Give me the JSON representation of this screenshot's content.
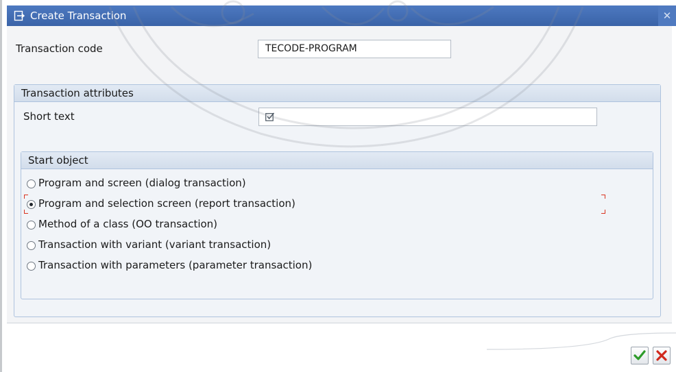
{
  "dialog": {
    "title": "Create Transaction",
    "close_glyph": "✕"
  },
  "form": {
    "transaction_code_label": "Transaction code",
    "transaction_code_value": "TECODE-PROGRAM"
  },
  "attributes_group": {
    "title": "Transaction attributes",
    "short_text_label": "Short text",
    "short_text_value": ""
  },
  "start_object": {
    "title": "Start object",
    "options": [
      {
        "label": "Program and screen (dialog transaction)",
        "selected": false
      },
      {
        "label": "Program and selection screen (report transaction)",
        "selected": true
      },
      {
        "label": "Method of a class (OO transaction)",
        "selected": false
      },
      {
        "label": "Transaction with variant (variant transaction)",
        "selected": false
      },
      {
        "label": "Transaction with parameters (parameter transaction)",
        "selected": false
      }
    ]
  },
  "footer": {
    "confirm_icon": "check-icon",
    "cancel_icon": "cross-icon"
  },
  "colors": {
    "titlebar": "#3f6cb5",
    "group_border": "#aec3de",
    "confirm": "#2e9b2a",
    "cancel": "#d0281c",
    "focus_bracket": "#d9321f"
  }
}
